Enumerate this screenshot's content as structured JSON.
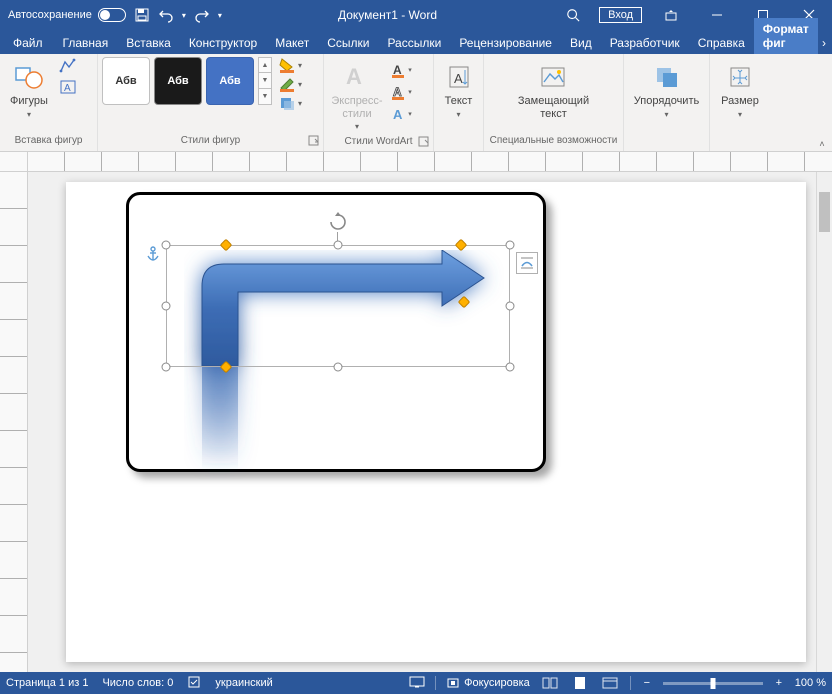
{
  "titlebar": {
    "autosave_label": "Автосохранение",
    "title": "Документ1  -  Word",
    "signin": "Вход"
  },
  "tabs": {
    "file": "Файл",
    "items": [
      "Главная",
      "Вставка",
      "Конструктор",
      "Макет",
      "Ссылки",
      "Рассылки",
      "Рецензирование",
      "Вид",
      "Разработчик",
      "Справка"
    ],
    "contextual": "Формат фиг"
  },
  "ribbon": {
    "shapes_btn": "Фигуры",
    "group_shapes_label": "Вставка фигур",
    "style_text": "Абв",
    "group_styles_label": "Стили фигур",
    "express_styles": "Экспресс-стили",
    "group_wordart_label": "Стили WordArt",
    "text_btn": "Текст",
    "alt_text_btn": "Замещающий текст",
    "group_access_label": "Специальные возможности",
    "arrange_btn": "Упорядочить",
    "size_btn": "Размер"
  },
  "statusbar": {
    "page": "Страница 1 из 1",
    "words": "Число слов: 0",
    "lang": "украинский",
    "focus": "Фокусировка",
    "zoom": "100 %"
  }
}
